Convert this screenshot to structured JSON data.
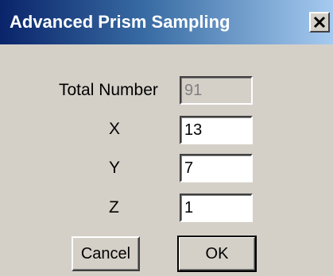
{
  "window": {
    "title": "Advanced Prism Sampling",
    "close_icon": "close-x-icon"
  },
  "fields": {
    "total": {
      "label": "Total Number",
      "value": "91"
    },
    "x": {
      "label": "X",
      "value": "13"
    },
    "y": {
      "label": "Y",
      "value": "7"
    },
    "z": {
      "label": "Z",
      "value": "1"
    }
  },
  "buttons": {
    "cancel": "Cancel",
    "ok": "OK"
  }
}
